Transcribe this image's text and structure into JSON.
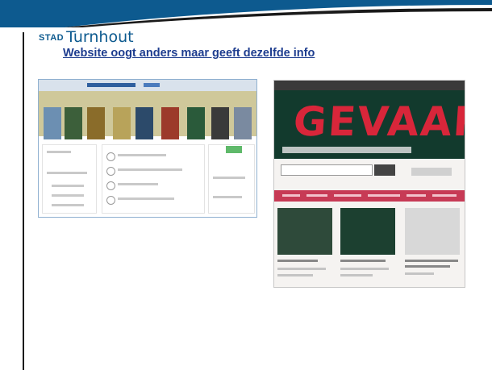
{
  "header": {
    "logo_prefix": "STAD",
    "logo_city": "Turnhout",
    "title": "Website oogt anders maar geeft dezelfde info"
  },
  "screenshots": {
    "right": {
      "hero_text": "GEVAAR!"
    }
  },
  "colors": {
    "brand_blue": "#0d5a8f",
    "title_blue": "#1e3d8f",
    "nav_red": "#c73a55",
    "hero_green": "#123a2d",
    "hero_red": "#d8263a"
  }
}
